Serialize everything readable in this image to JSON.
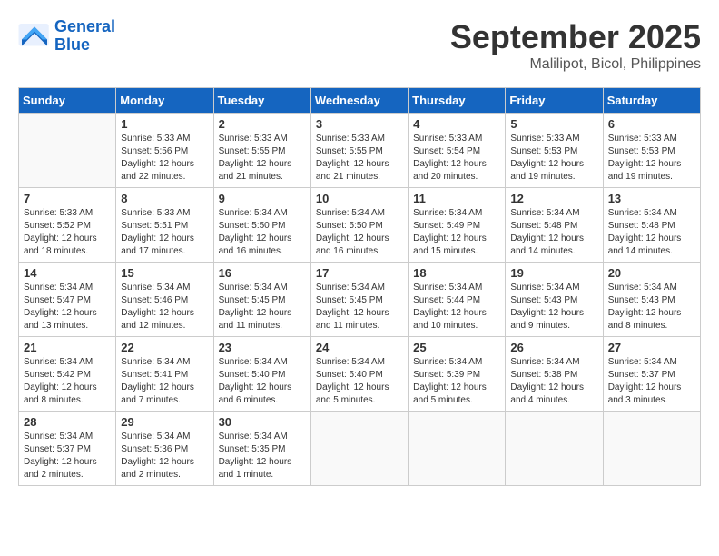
{
  "logo": {
    "line1": "General",
    "line2": "Blue"
  },
  "title": "September 2025",
  "location": "Malilipot, Bicol, Philippines",
  "weekdays": [
    "Sunday",
    "Monday",
    "Tuesday",
    "Wednesday",
    "Thursday",
    "Friday",
    "Saturday"
  ],
  "weeks": [
    [
      {
        "day": "",
        "info": ""
      },
      {
        "day": "1",
        "info": "Sunrise: 5:33 AM\nSunset: 5:56 PM\nDaylight: 12 hours\nand 22 minutes."
      },
      {
        "day": "2",
        "info": "Sunrise: 5:33 AM\nSunset: 5:55 PM\nDaylight: 12 hours\nand 21 minutes."
      },
      {
        "day": "3",
        "info": "Sunrise: 5:33 AM\nSunset: 5:55 PM\nDaylight: 12 hours\nand 21 minutes."
      },
      {
        "day": "4",
        "info": "Sunrise: 5:33 AM\nSunset: 5:54 PM\nDaylight: 12 hours\nand 20 minutes."
      },
      {
        "day": "5",
        "info": "Sunrise: 5:33 AM\nSunset: 5:53 PM\nDaylight: 12 hours\nand 19 minutes."
      },
      {
        "day": "6",
        "info": "Sunrise: 5:33 AM\nSunset: 5:53 PM\nDaylight: 12 hours\nand 19 minutes."
      }
    ],
    [
      {
        "day": "7",
        "info": "Sunrise: 5:33 AM\nSunset: 5:52 PM\nDaylight: 12 hours\nand 18 minutes."
      },
      {
        "day": "8",
        "info": "Sunrise: 5:33 AM\nSunset: 5:51 PM\nDaylight: 12 hours\nand 17 minutes."
      },
      {
        "day": "9",
        "info": "Sunrise: 5:34 AM\nSunset: 5:50 PM\nDaylight: 12 hours\nand 16 minutes."
      },
      {
        "day": "10",
        "info": "Sunrise: 5:34 AM\nSunset: 5:50 PM\nDaylight: 12 hours\nand 16 minutes."
      },
      {
        "day": "11",
        "info": "Sunrise: 5:34 AM\nSunset: 5:49 PM\nDaylight: 12 hours\nand 15 minutes."
      },
      {
        "day": "12",
        "info": "Sunrise: 5:34 AM\nSunset: 5:48 PM\nDaylight: 12 hours\nand 14 minutes."
      },
      {
        "day": "13",
        "info": "Sunrise: 5:34 AM\nSunset: 5:48 PM\nDaylight: 12 hours\nand 14 minutes."
      }
    ],
    [
      {
        "day": "14",
        "info": "Sunrise: 5:34 AM\nSunset: 5:47 PM\nDaylight: 12 hours\nand 13 minutes."
      },
      {
        "day": "15",
        "info": "Sunrise: 5:34 AM\nSunset: 5:46 PM\nDaylight: 12 hours\nand 12 minutes."
      },
      {
        "day": "16",
        "info": "Sunrise: 5:34 AM\nSunset: 5:45 PM\nDaylight: 12 hours\nand 11 minutes."
      },
      {
        "day": "17",
        "info": "Sunrise: 5:34 AM\nSunset: 5:45 PM\nDaylight: 12 hours\nand 11 minutes."
      },
      {
        "day": "18",
        "info": "Sunrise: 5:34 AM\nSunset: 5:44 PM\nDaylight: 12 hours\nand 10 minutes."
      },
      {
        "day": "19",
        "info": "Sunrise: 5:34 AM\nSunset: 5:43 PM\nDaylight: 12 hours\nand 9 minutes."
      },
      {
        "day": "20",
        "info": "Sunrise: 5:34 AM\nSunset: 5:43 PM\nDaylight: 12 hours\nand 8 minutes."
      }
    ],
    [
      {
        "day": "21",
        "info": "Sunrise: 5:34 AM\nSunset: 5:42 PM\nDaylight: 12 hours\nand 8 minutes."
      },
      {
        "day": "22",
        "info": "Sunrise: 5:34 AM\nSunset: 5:41 PM\nDaylight: 12 hours\nand 7 minutes."
      },
      {
        "day": "23",
        "info": "Sunrise: 5:34 AM\nSunset: 5:40 PM\nDaylight: 12 hours\nand 6 minutes."
      },
      {
        "day": "24",
        "info": "Sunrise: 5:34 AM\nSunset: 5:40 PM\nDaylight: 12 hours\nand 5 minutes."
      },
      {
        "day": "25",
        "info": "Sunrise: 5:34 AM\nSunset: 5:39 PM\nDaylight: 12 hours\nand 5 minutes."
      },
      {
        "day": "26",
        "info": "Sunrise: 5:34 AM\nSunset: 5:38 PM\nDaylight: 12 hours\nand 4 minutes."
      },
      {
        "day": "27",
        "info": "Sunrise: 5:34 AM\nSunset: 5:37 PM\nDaylight: 12 hours\nand 3 minutes."
      }
    ],
    [
      {
        "day": "28",
        "info": "Sunrise: 5:34 AM\nSunset: 5:37 PM\nDaylight: 12 hours\nand 2 minutes."
      },
      {
        "day": "29",
        "info": "Sunrise: 5:34 AM\nSunset: 5:36 PM\nDaylight: 12 hours\nand 2 minutes."
      },
      {
        "day": "30",
        "info": "Sunrise: 5:34 AM\nSunset: 5:35 PM\nDaylight: 12 hours\nand 1 minute."
      },
      {
        "day": "",
        "info": ""
      },
      {
        "day": "",
        "info": ""
      },
      {
        "day": "",
        "info": ""
      },
      {
        "day": "",
        "info": ""
      }
    ]
  ]
}
